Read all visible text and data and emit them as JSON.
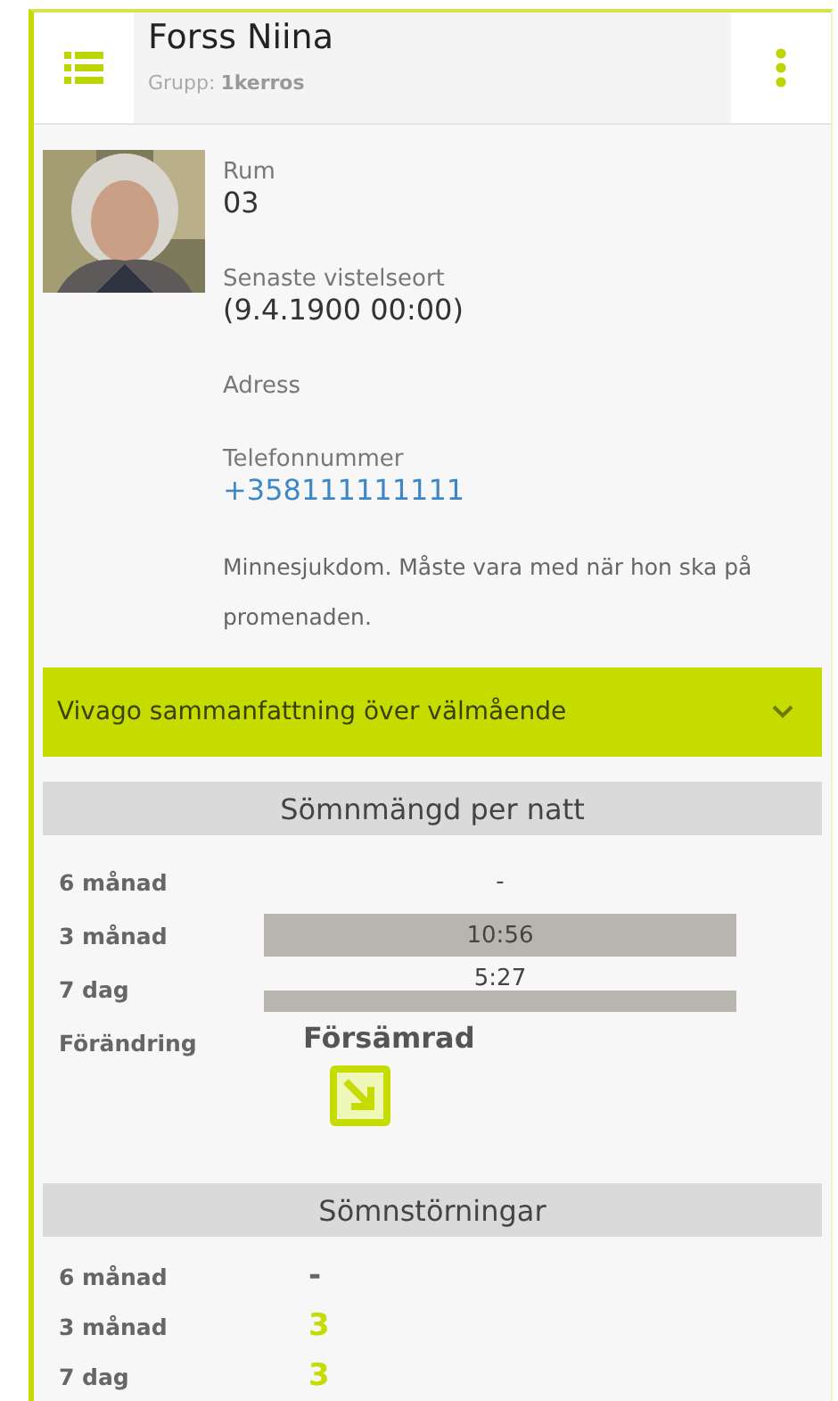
{
  "header": {
    "name": "Forss Niina",
    "group_label": "Grupp:",
    "group_value": "1kerros"
  },
  "profile": {
    "fields": [
      {
        "label": "Rum",
        "value": "03",
        "kind": "text"
      },
      {
        "label": "Senaste vistelseort",
        "value": "(9.4.1900 00:00)",
        "kind": "text"
      },
      {
        "label": "Adress"
      },
      {
        "label": "Telefonnummer",
        "value": "+358111111111",
        "kind": "phone"
      }
    ],
    "note": "Minnesjukdom. Måste vara med när hon ska på promenaden."
  },
  "summary": {
    "title": "Vivago sammanfattning över välmående",
    "expanded": false
  },
  "sleep_amount": {
    "title": "Sömnmängd per natt",
    "rows": [
      {
        "label": "6 månad",
        "value": "-",
        "kind": "none"
      },
      {
        "label": "3 månad",
        "value": "10:56",
        "kind": "bar"
      },
      {
        "label": "7 dag",
        "value": "5:27",
        "kind": "thin-bar"
      }
    ],
    "change_label": "Förändring",
    "change_value": "Försämrad",
    "declining": true
  },
  "sleep_disturbances": {
    "title": "Sömnstörningar",
    "rows": [
      {
        "label": "6 månad",
        "value": "-",
        "highlight": false
      },
      {
        "label": "3 månad",
        "value": "3",
        "highlight": true
      },
      {
        "label": "7 dag",
        "value": "3",
        "highlight": true
      }
    ]
  }
}
